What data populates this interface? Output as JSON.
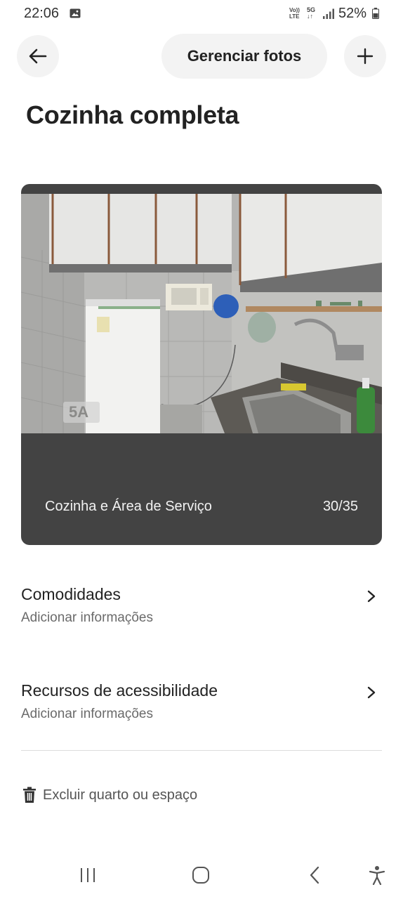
{
  "status_bar": {
    "time": "22:06",
    "volte_top": "Vo))",
    "volte_bottom": "LTE",
    "network_top": "5G",
    "network_bottom": "↓↑",
    "battery": "52%",
    "icons": [
      "image-notification-icon",
      "volte-icon",
      "5g-icon",
      "signal-icon",
      "battery-icon"
    ]
  },
  "header": {
    "back_icon": "arrow-left-icon",
    "manage_photos_label": "Gerenciar fotos",
    "add_icon": "plus-icon"
  },
  "page": {
    "title": "Cozinha completa"
  },
  "photo": {
    "caption": "Cozinha e Área de Serviço",
    "counter": "30/35",
    "watermark": "5A"
  },
  "rows": [
    {
      "title": "Comodidades",
      "subtitle": "Adicionar informações",
      "icon": "chevron-right-icon"
    },
    {
      "title": "Recursos de acessibilidade",
      "subtitle": "Adicionar informações",
      "icon": "chevron-right-icon"
    }
  ],
  "delete": {
    "label": "Excluir quarto ou espaço",
    "icon": "trash-icon"
  },
  "nav_bar": {
    "icons": [
      "recent-apps-icon",
      "home-icon",
      "back-icon",
      "accessibility-icon"
    ]
  },
  "colors": {
    "card_background": "#434343",
    "button_background": "#f3f3f3",
    "divider": "#dddddd"
  }
}
